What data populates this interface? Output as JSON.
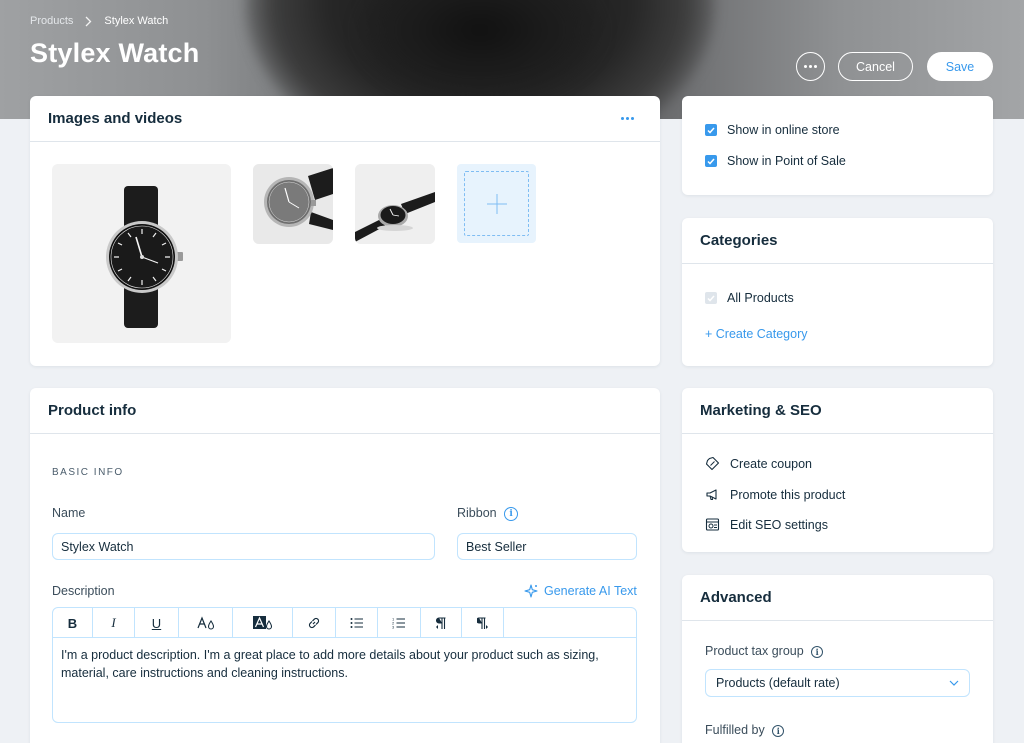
{
  "header": {
    "breadcrumb": {
      "parent": "Products",
      "current": "Stylex Watch"
    },
    "title": "Stylex Watch",
    "cancel_label": "Cancel",
    "save_label": "Save"
  },
  "images_card": {
    "title": "Images and videos"
  },
  "product_info": {
    "title": "Product info",
    "section_label": "BASIC INFO",
    "name_label": "Name",
    "name_value": "Stylex Watch",
    "ribbon_label": "Ribbon",
    "ribbon_value": "Best Seller",
    "description_label": "Description",
    "generate_ai_label": "Generate AI Text",
    "description_text": "I'm a product description. I'm a great place to add more details about your product such as sizing, material, care instructions and cleaning instructions.",
    "toolbar": [
      "B",
      "I",
      "U"
    ]
  },
  "visibility": {
    "online_store": "Show in online store",
    "point_of_sale": "Show in Point of Sale"
  },
  "categories": {
    "title": "Categories",
    "all_products": "All Products",
    "create_category": "+ Create Category"
  },
  "marketing": {
    "title": "Marketing & SEO",
    "items": [
      "Create coupon",
      "Promote this product",
      "Edit SEO settings"
    ]
  },
  "advanced": {
    "title": "Advanced",
    "tax_group_label": "Product tax group",
    "tax_group_value": "Products (default rate)",
    "fulfilled_by_label": "Fulfilled by"
  },
  "colors": {
    "accent": "#3899ec",
    "text": "#162d3d",
    "border": "#c1e4fe"
  }
}
